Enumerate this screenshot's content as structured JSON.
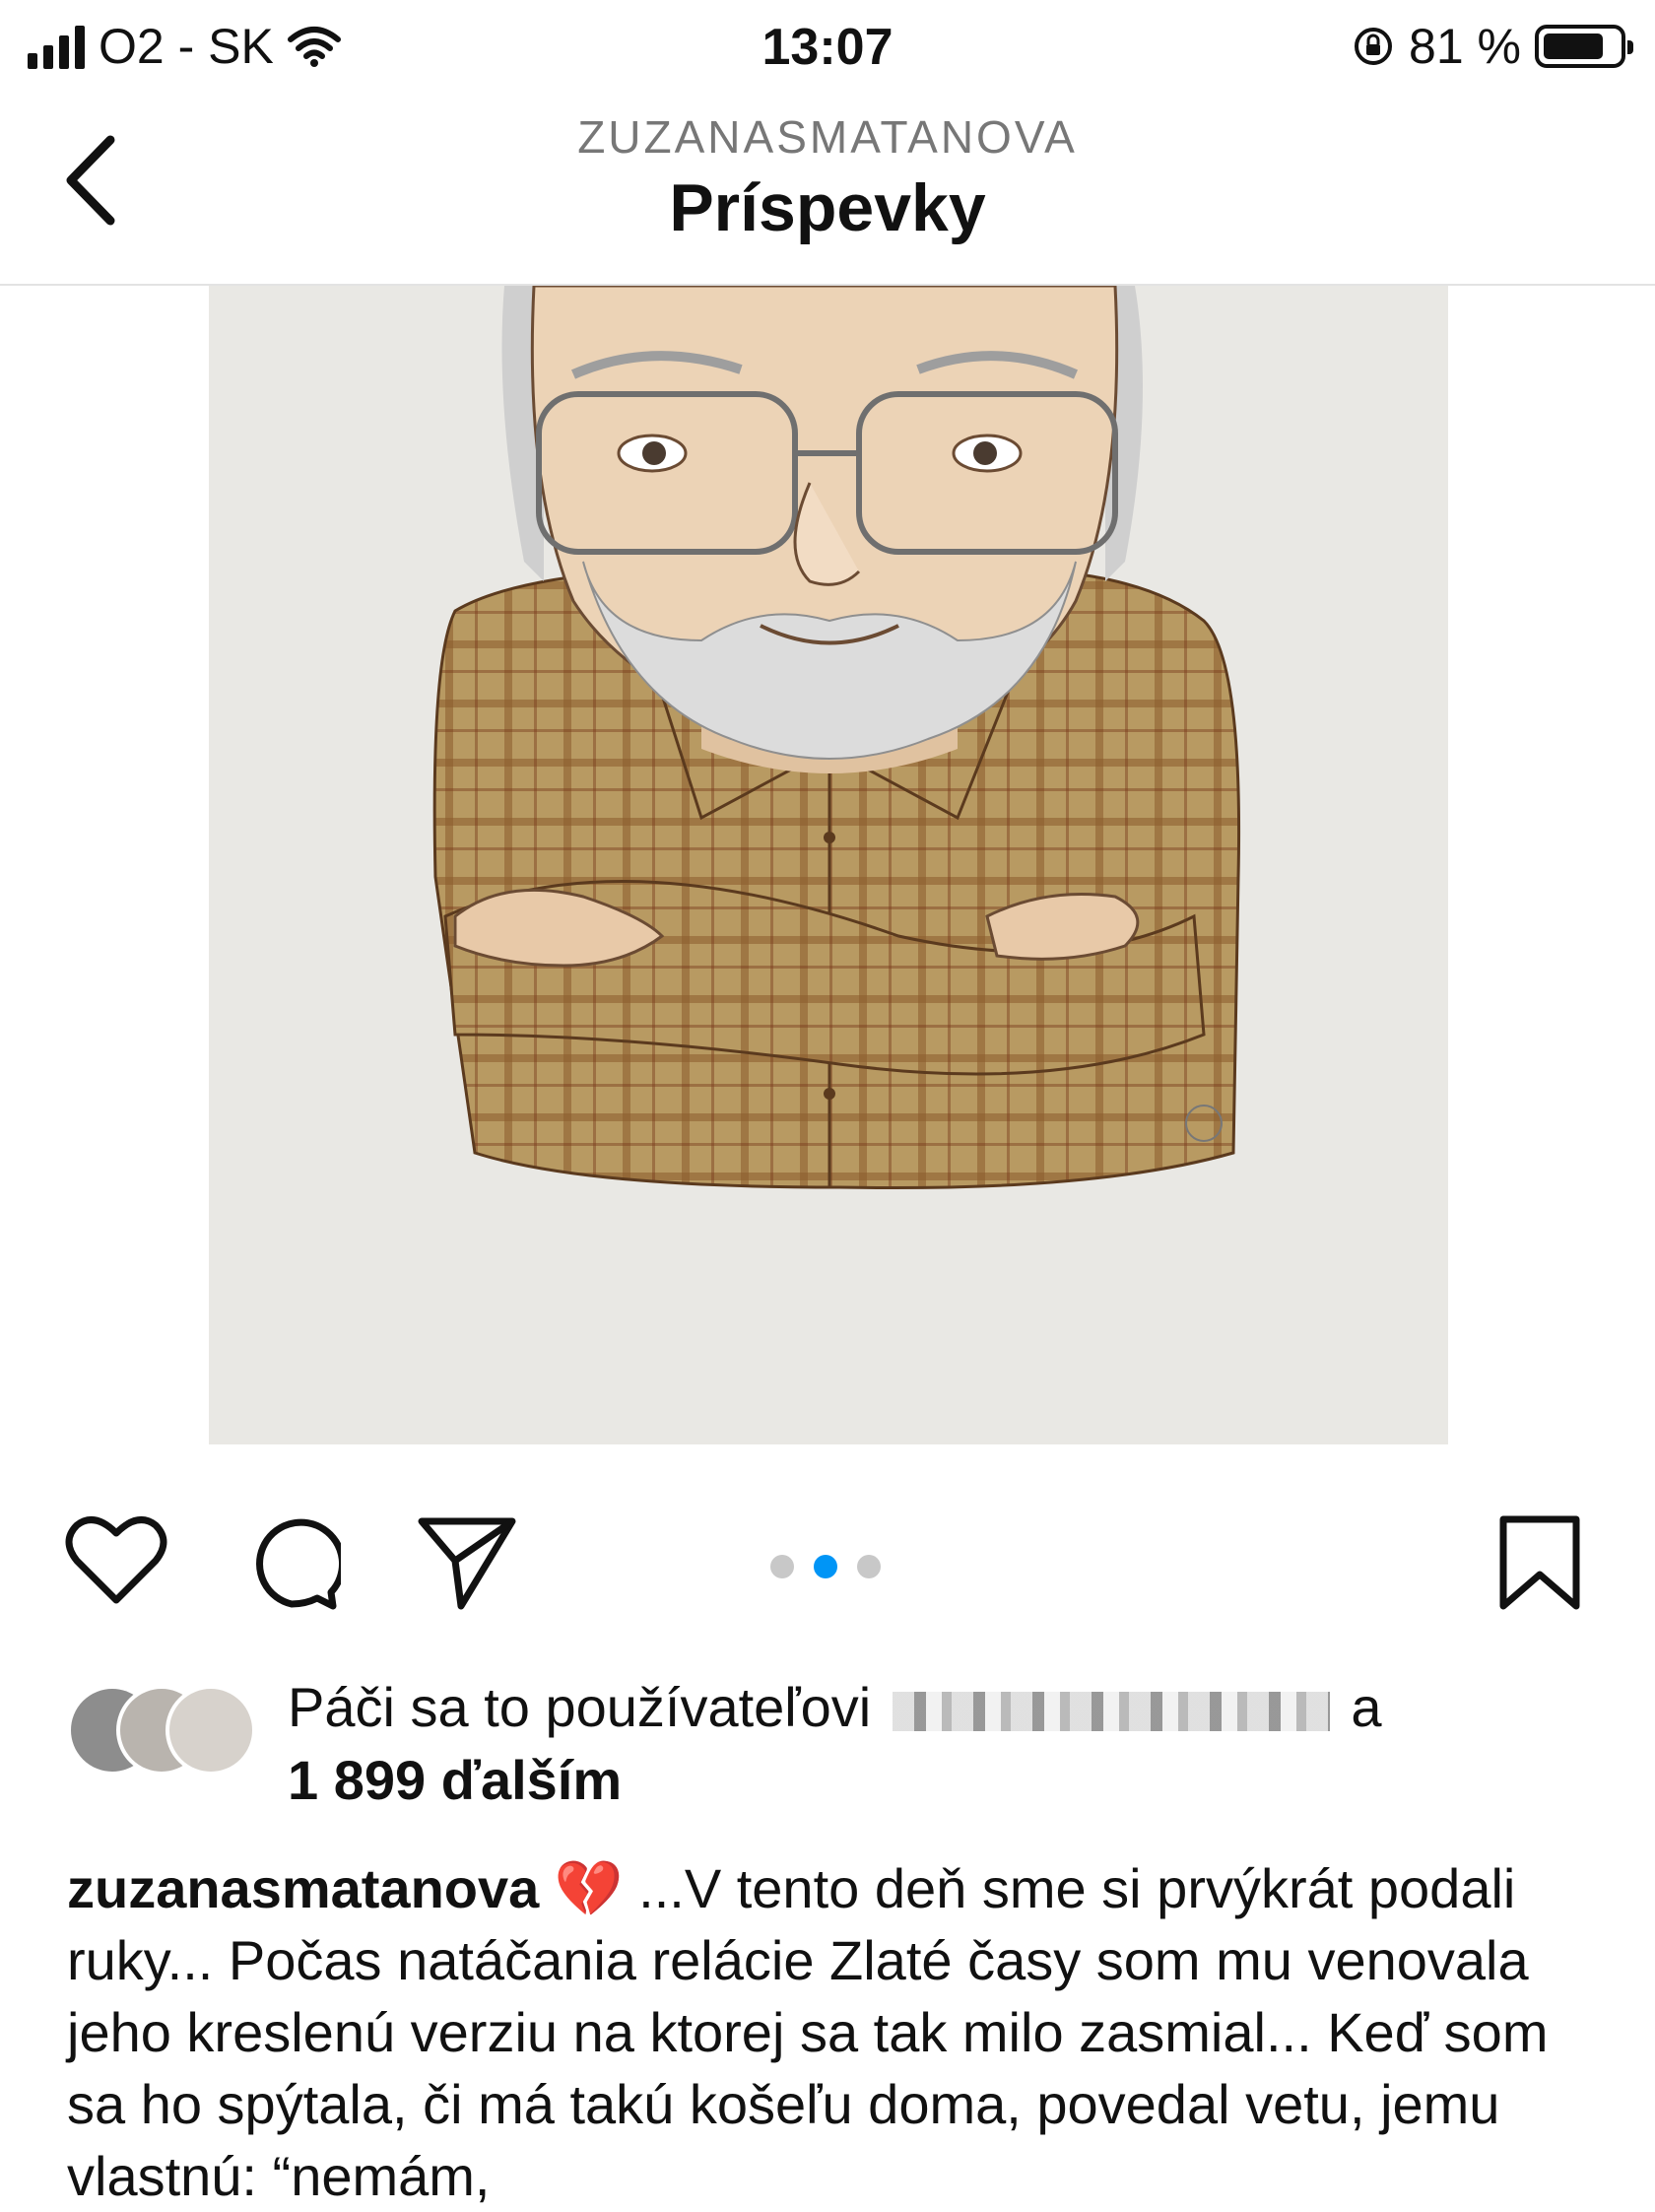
{
  "status_bar": {
    "carrier": "O2 - SK",
    "time": "13:07",
    "battery_percent": "81 %",
    "battery_level": 0.81
  },
  "header": {
    "username": "ZUZANASMATANOVA",
    "title": "Príspevky"
  },
  "post": {
    "image_description": "caricature drawing of an elderly man with glasses, grey beard and plaid shirt, arms crossed",
    "carousel": {
      "count": 3,
      "active_index": 1
    },
    "likes": {
      "prefix": "Páči sa to používateľovi",
      "suffix": "a",
      "count_text": "1 899 ďalším"
    },
    "caption": {
      "username": "zuzanasmatanova",
      "emoji": "💔",
      "text": "...V tento deň sme si prvýkrát podali ruky... Počas natáčania relácie Zlaté časy som mu venovala jeho kreslenú verziu na ktorej sa tak milo zasmial... Keď som sa ho spýtala, či má takú košeľu doma, povedal vetu, jemu vlastnú: “nemám,"
    }
  },
  "colors": {
    "accent": "#0095f6",
    "text": "#111111",
    "secondary_text": "#777777",
    "divider": "#e3e3e3",
    "image_background": "#e9e8e4"
  },
  "icons": {
    "back": "chevron-left-icon",
    "like": "heart-icon",
    "comment": "comment-bubble-icon",
    "share": "paper-plane-icon",
    "save": "bookmark-icon"
  }
}
